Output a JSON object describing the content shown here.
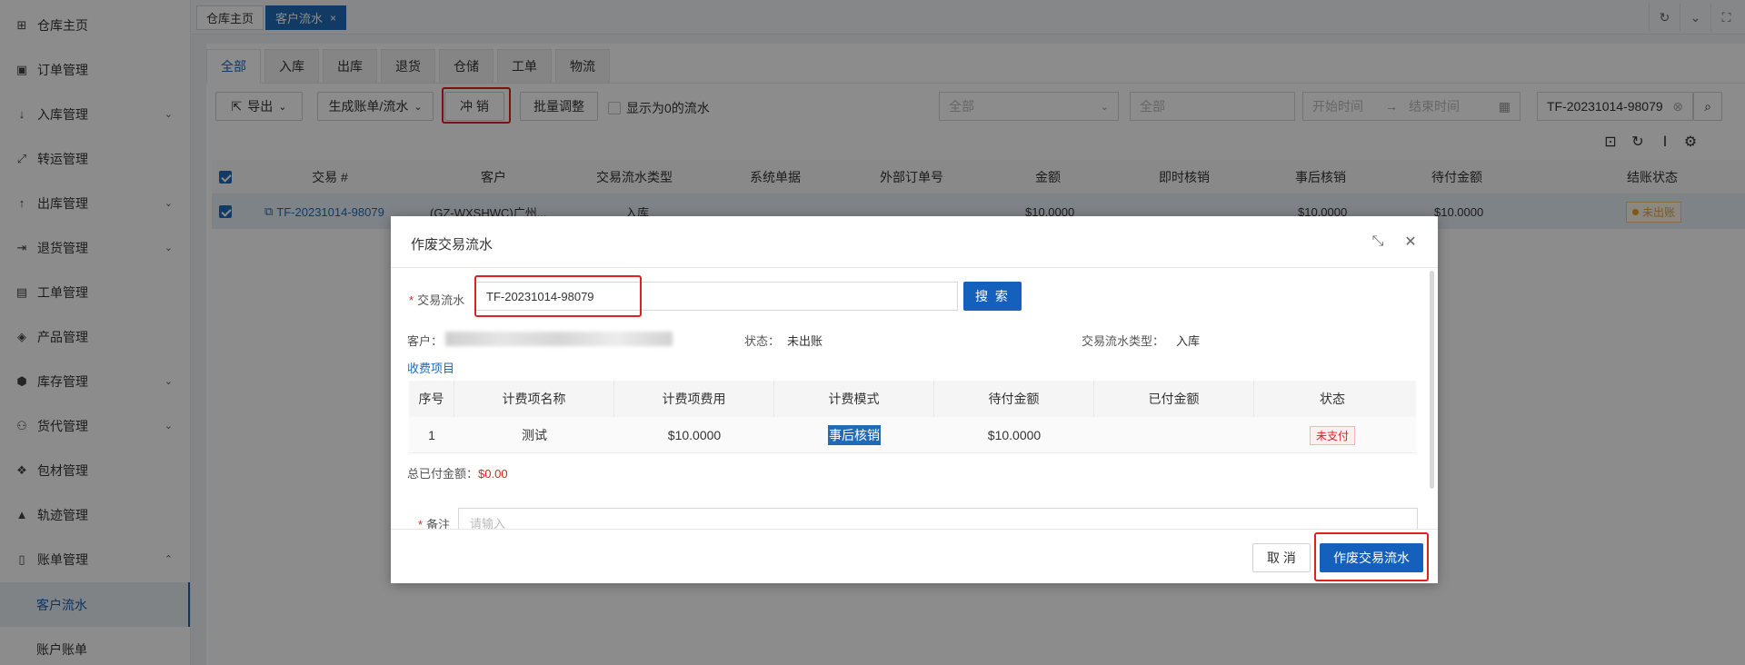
{
  "sidebar": {
    "items": [
      {
        "label": "仓库主页",
        "icon": "grid-icon",
        "arrow": ""
      },
      {
        "label": "订单管理",
        "icon": "order-icon",
        "arrow": ""
      },
      {
        "label": "入库管理",
        "icon": "inbound-icon",
        "arrow": "⌄"
      },
      {
        "label": "转运管理",
        "icon": "transfer-icon",
        "arrow": ""
      },
      {
        "label": "出库管理",
        "icon": "outbound-icon",
        "arrow": "⌄"
      },
      {
        "label": "退货管理",
        "icon": "return-icon",
        "arrow": "⌄"
      },
      {
        "label": "工单管理",
        "icon": "ticket-icon",
        "arrow": ""
      },
      {
        "label": "产品管理",
        "icon": "product-icon",
        "arrow": ""
      },
      {
        "label": "库存管理",
        "icon": "stock-icon",
        "arrow": "⌄"
      },
      {
        "label": "货代管理",
        "icon": "forwarder-icon",
        "arrow": "⌄"
      },
      {
        "label": "包材管理",
        "icon": "package-icon",
        "arrow": ""
      },
      {
        "label": "轨迹管理",
        "icon": "track-icon",
        "arrow": ""
      },
      {
        "label": "账单管理",
        "icon": "bill-icon",
        "arrow": "⌃"
      }
    ],
    "sub_items": [
      {
        "label": "客户流水",
        "active": true
      },
      {
        "label": "账户账单",
        "active": false
      }
    ]
  },
  "page_tabs": [
    {
      "label": "仓库主页",
      "active": false,
      "close": ""
    },
    {
      "label": "客户流水",
      "active": true,
      "close": "×"
    }
  ],
  "content_tabs": [
    "全部",
    "入库",
    "出库",
    "退货",
    "仓储",
    "工单",
    "物流"
  ],
  "toolbar": {
    "export_label": "导出",
    "generate_label": "生成账单/流水",
    "reverse_label": "冲 销",
    "batch_label": "批量调整",
    "show_zero_label": "显示为0的流水",
    "filter1_placeholder": "全部",
    "filter2_placeholder": "全部",
    "start_placeholder": "开始时间",
    "end_placeholder": "结束时间",
    "search_value": "TF-20231014-98079"
  },
  "table": {
    "headers": [
      "交易 #",
      "客户",
      "交易流水类型",
      "系统单据",
      "外部订单号",
      "金额",
      "即时核销",
      "事后核销",
      "待付金额",
      "结账状态"
    ],
    "row": {
      "txn": "TF-20231014-98079",
      "customer": "(GZ-WXSHWC)广州...",
      "type": "入库",
      "amount": "$10.0000",
      "after": "$10.0000",
      "pending": "$10.0000",
      "status": "未出账"
    }
  },
  "modal": {
    "title": "作废交易流水",
    "txn_label": "交易流水",
    "txn_value": "TF-20231014-98079",
    "search_label": "搜 索",
    "customer_label": "客户：",
    "status_label": "状态：",
    "status_value": "未出账",
    "type_label": "交易流水类型：",
    "type_value": "入库",
    "items_title": "收费项目",
    "item_headers": [
      "序号",
      "计费项名称",
      "计费项费用",
      "计费模式",
      "待付金额",
      "已付金额",
      "状态"
    ],
    "item_row": {
      "no": "1",
      "name": "测试",
      "fee": "$10.0000",
      "mode": "事后核销",
      "pending": "$10.0000",
      "paid": "",
      "status": "未支付"
    },
    "total_label": "总已付金额：",
    "total_value": "$0.00",
    "remark_label": "备注",
    "remark_placeholder": "请输入",
    "cancel_label": "取 消",
    "confirm_label": "作废交易流水"
  },
  "colors": {
    "primary": "#1f6bb8",
    "danger": "#e02020",
    "warning_dot": "#f0a020"
  }
}
